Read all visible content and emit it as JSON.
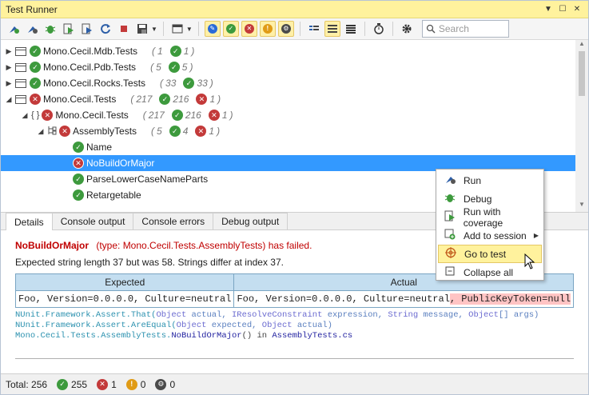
{
  "window": {
    "title": "Test Runner"
  },
  "toolbar": {
    "search_placeholder": "Search"
  },
  "tree": {
    "rows": [
      {
        "label": "Mono.Cecil.Mdb.Tests",
        "total": "1",
        "passed": "1",
        "failed": ""
      },
      {
        "label": "Mono.Cecil.Pdb.Tests",
        "total": "5",
        "passed": "5",
        "failed": ""
      },
      {
        "label": "Mono.Cecil.Rocks.Tests",
        "total": "33",
        "passed": "33",
        "failed": ""
      },
      {
        "label": "Mono.Cecil.Tests",
        "total": "217",
        "passed": "216",
        "failed": "1"
      },
      {
        "label": "Mono.Cecil.Tests",
        "total": "217",
        "passed": "216",
        "failed": "1"
      },
      {
        "label": "AssemblyTests",
        "total": "5",
        "passed": "4",
        "failed": "1"
      },
      {
        "label": "Name"
      },
      {
        "label": "NoBuildOrMajor"
      },
      {
        "label": "ParseLowerCaseNameParts"
      },
      {
        "label": "Retargetable"
      }
    ],
    "ns_icon": "{ }"
  },
  "tabs": [
    "Details",
    "Console output",
    "Console errors",
    "Debug output"
  ],
  "details": {
    "test_name": "NoBuildOrMajor",
    "failure_text": "(type: Mono.Cecil.Tests.AssemblyTests) has failed.",
    "message": "Expected string length 37 but was 58. Strings differ at index 37.",
    "expected_header": "Expected",
    "actual_header": "Actual",
    "expected_value": "Foo, Version=0.0.0.0, Culture=neutral",
    "actual_value_same": "Foo, Version=0.0.0.0, Culture=neutral",
    "actual_value_diff": ", PublicKeyToken=null",
    "stack": {
      "l1_a": "NUnit.Framework.Assert.That(",
      "l1_b": "Object",
      "l1_c": " actual, ",
      "l1_d": "IResolveConstraint",
      "l1_e": " expression, ",
      "l1_f": "String",
      "l1_g": " message, ",
      "l1_h": "Object",
      "l1_i": "[] args)",
      "l2_a": "NUnit.Framework.Assert.AreEqual(",
      "l2_b": "Object",
      "l2_c": " expected, ",
      "l2_d": "Object",
      "l2_e": " actual)",
      "l3_a": "Mono.Cecil.Tests.AssemblyTests.",
      "l3_b": "NoBuildOrMajor",
      "l3_c": "() in ",
      "l3_d": "AssemblyTests.cs"
    }
  },
  "status": {
    "total_label": "Total: 256",
    "passed": "255",
    "failed": "1",
    "warnings": "0",
    "skipped": "0"
  },
  "context_menu": {
    "items": [
      "Run",
      "Debug",
      "Run with coverage",
      "Add to session",
      "Go to test",
      "Collapse all"
    ]
  }
}
